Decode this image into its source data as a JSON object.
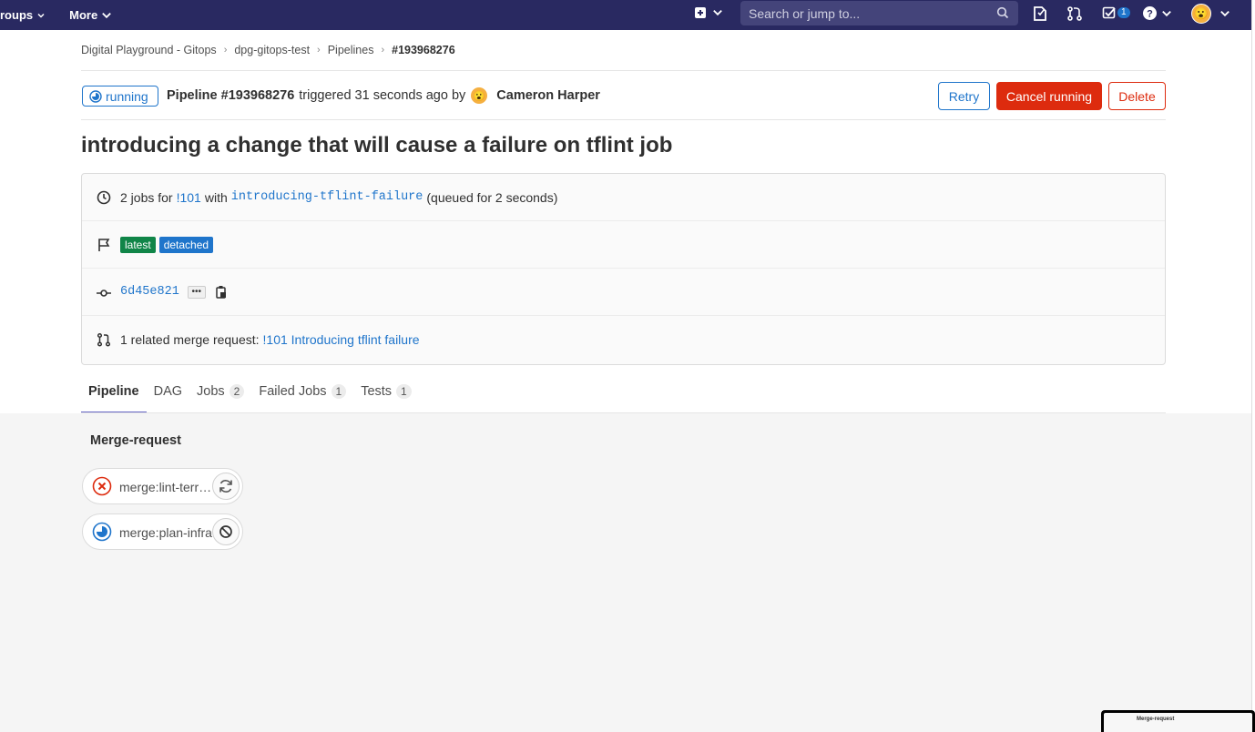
{
  "topnav": {
    "groups_label": "roups",
    "more_label": "More",
    "search_placeholder": "Search or jump to...",
    "todo_count": "1"
  },
  "breadcrumb": [
    "Digital Playground - Gitops",
    "dpg-gitops-test",
    "Pipelines",
    "#193968276"
  ],
  "header": {
    "status": "running",
    "pipeline_label": "Pipeline #193968276",
    "triggered_text": "triggered 31 seconds ago by",
    "author": "Cameron Harper",
    "retry": "Retry",
    "cancel": "Cancel running",
    "delete": "Delete"
  },
  "title": "introducing a change that will cause a failure on tflint job",
  "info": {
    "jobs_prefix": "2 jobs for",
    "mr_ref": "!101",
    "with_text": "with",
    "branch": "introducing-tflint-failure",
    "queued_text": "(queued for 2 seconds)",
    "labels": [
      "latest",
      "detached"
    ],
    "commit_sha": "6d45e821",
    "related_prefix": "1 related merge request:",
    "related_mr": "!101 Introducing tflint failure"
  },
  "tabs": [
    {
      "label": "Pipeline",
      "count": ""
    },
    {
      "label": "DAG",
      "count": ""
    },
    {
      "label": "Jobs",
      "count": "2"
    },
    {
      "label": "Failed Jobs",
      "count": "1"
    },
    {
      "label": "Tests",
      "count": "1"
    }
  ],
  "graph": {
    "stage": "Merge-request",
    "jobs": [
      {
        "name": "merge:lint-terraform",
        "status": "failed",
        "action": "retry"
      },
      {
        "name": "merge:plan-infra",
        "status": "running",
        "action": "cancel"
      }
    ],
    "minimap_label": "Merge-request"
  },
  "colors": {
    "nav_bg": "#292961",
    "link": "#1f75cb",
    "danger": "#dd2b0e",
    "success": "#108548"
  }
}
